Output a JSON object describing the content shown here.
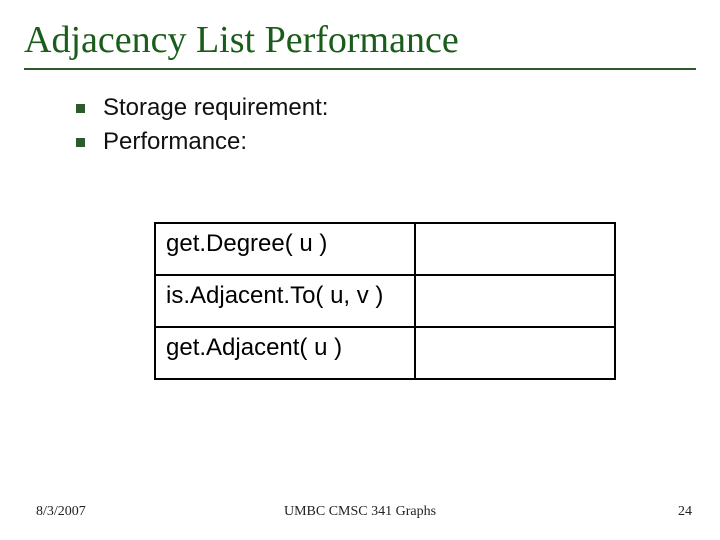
{
  "title": "Adjacency List Performance",
  "bullets": [
    {
      "text": "Storage requirement:"
    },
    {
      "text": "Performance:"
    }
  ],
  "table": {
    "rows": [
      {
        "op": "get.Degree( u )",
        "val": ""
      },
      {
        "op": "is.Adjacent.To( u, v )",
        "val": ""
      },
      {
        "op": "get.Adjacent( u )",
        "val": ""
      }
    ]
  },
  "footer": {
    "date": "8/3/2007",
    "center": "UMBC CMSC 341 Graphs",
    "page": "24"
  }
}
